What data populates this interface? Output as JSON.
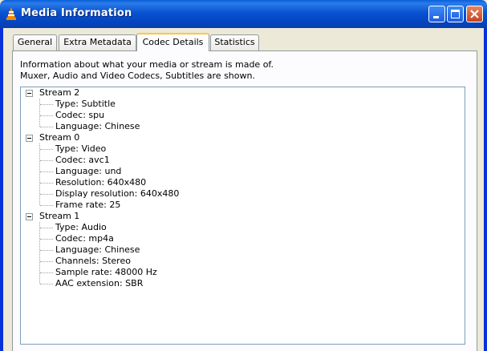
{
  "window": {
    "title": "Media Information"
  },
  "tabs": [
    {
      "label": "General",
      "active": false
    },
    {
      "label": "Extra Metadata",
      "active": false
    },
    {
      "label": "Codec Details",
      "active": true
    },
    {
      "label": "Statistics",
      "active": false
    }
  ],
  "codec": {
    "description_line1": "Information about what your media or stream is made of.",
    "description_line2": "Muxer, Audio and Video Codecs, Subtitles are shown.",
    "streams": [
      {
        "name": "Stream 2",
        "props": [
          "Type: Subtitle",
          "Codec: spu",
          "Language: Chinese"
        ]
      },
      {
        "name": "Stream 0",
        "props": [
          "Type: Video",
          "Codec: avc1",
          "Language: und",
          "Resolution: 640x480",
          "Display resolution: 640x480",
          "Frame rate: 25"
        ]
      },
      {
        "name": "Stream 1",
        "props": [
          "Type: Audio",
          "Codec: mp4a",
          "Language: Chinese",
          "Channels: Stereo",
          "Sample rate: 48000 Hz",
          "AAC extension: SBR"
        ]
      }
    ]
  },
  "colors": {
    "titlebar": "#0852d0",
    "tab_highlight": "#ffc83c",
    "tree_lines": "#a0a0a0"
  },
  "icons": {
    "app": "vlc-cone-icon",
    "minimize": "minimize-icon",
    "maximize": "maximize-icon",
    "close": "close-icon",
    "expander": "tree-collapse-icon"
  }
}
